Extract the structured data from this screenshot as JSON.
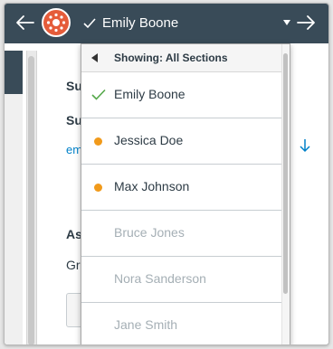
{
  "topbar": {
    "selected_student": "Emily Boone",
    "icons": {
      "back": "left-arrow-icon",
      "forward": "right-arrow-icon",
      "logo": "canvas-logo-icon",
      "check": "checkmark-icon",
      "caret": "caret-down-icon"
    }
  },
  "background": {
    "sub1": "Su",
    "sub2": "Su",
    "link": "em",
    "assign": "As",
    "grade": "Gr"
  },
  "dropdown": {
    "header": "Showing: All Sections",
    "students": [
      {
        "name": "Emily Boone",
        "status": "selected"
      },
      {
        "name": "Jessica Doe",
        "status": "submitted"
      },
      {
        "name": "Max Johnson",
        "status": "submitted"
      },
      {
        "name": "Bruce Jones",
        "status": "not-submitted"
      },
      {
        "name": "Nora Sanderson",
        "status": "not-submitted"
      },
      {
        "name": "Jane Smith",
        "status": "not-submitted"
      }
    ]
  },
  "colors": {
    "topbar": "#394b58",
    "check_green": "#55a84a",
    "dot_orange": "#f19a1b",
    "muted_text": "#a5afb5",
    "link_blue": "#0081c9"
  }
}
